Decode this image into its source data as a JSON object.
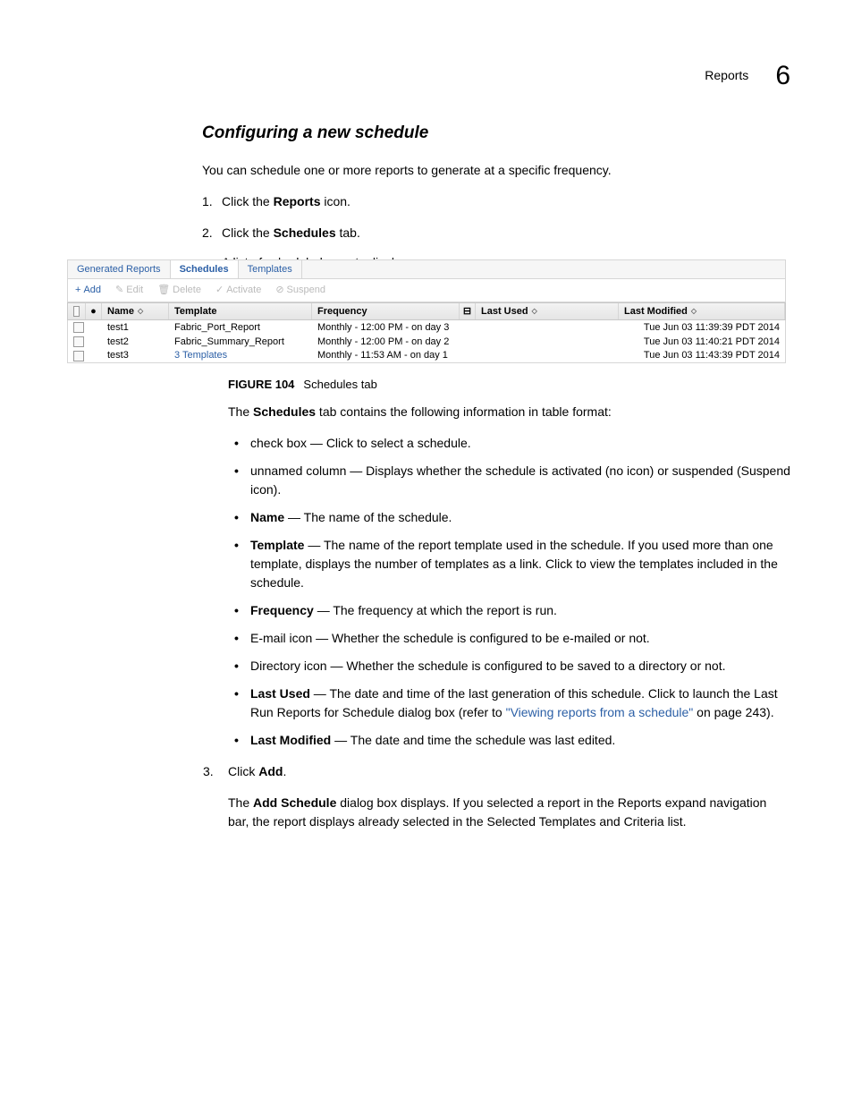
{
  "header": {
    "section": "Reports",
    "chapter": "6"
  },
  "title": "Configuring a new schedule",
  "intro": "You can schedule one or more reports to generate at a specific frequency.",
  "steps12": {
    "s1_pre": "Click the ",
    "s1_b": "Reports",
    "s1_post": " icon.",
    "s2_pre": "Click the ",
    "s2_b": "Schedules",
    "s2_post": " tab.",
    "s2_sub": "A list of scheduled reports display."
  },
  "screenshot": {
    "tabs": {
      "gen": "Generated Reports",
      "sched": "Schedules",
      "tmpl": "Templates"
    },
    "toolbar": {
      "add": "Add",
      "edit": "Edit",
      "del": "Delete",
      "act": "Activate",
      "susp": "Suspend"
    },
    "cols": {
      "name": "Name",
      "tmpl": "Template",
      "freq": "Frequency",
      "lu": "Last Used",
      "lm": "Last Modified"
    },
    "rows": [
      {
        "name": "test1",
        "tmpl": "Fabric_Port_Report",
        "tmpl_link": false,
        "freq": "Monthly - 12:00 PM - on day 3",
        "lm": "Tue Jun 03 11:39:39 PDT 2014"
      },
      {
        "name": "test2",
        "tmpl": "Fabric_Summary_Report",
        "tmpl_link": false,
        "freq": "Monthly - 12:00 PM - on day 2",
        "lm": "Tue Jun 03 11:40:21 PDT 2014"
      },
      {
        "name": "test3",
        "tmpl": "3 Templates",
        "tmpl_link": true,
        "freq": "Monthly - 11:53 AM - on day 1",
        "lm": "Tue Jun 03 11:43:39 PDT 2014"
      }
    ]
  },
  "figure": {
    "label": "FIGURE 104",
    "caption": "Schedules tab"
  },
  "desc_intro_pre": "The ",
  "desc_intro_b": "Schedules",
  "desc_intro_post": " tab contains the following information in table format:",
  "bullets": {
    "b1": "check box — Click to select a schedule.",
    "b2": "unnamed column — Displays whether the schedule is activated (no icon) or suspended (Suspend icon).",
    "b3_b": "Name",
    "b3_r": " — The name of the schedule.",
    "b4_b": "Template",
    "b4_r": " — The name of the report template used in the schedule. If you used more than one template, displays the number of templates as a link. Click to view the templates included in the schedule.",
    "b5_b": "Frequency",
    "b5_r": " — The frequency at which the report is run.",
    "b6": "E-mail icon — Whether the schedule is configured to be e-mailed or not.",
    "b7": "Directory icon — Whether the schedule is configured to be saved to a directory or not.",
    "b8_b": "Last Used",
    "b8_r1": " — The date and time of the last generation of this schedule. Click to launch the Last Run Reports for Schedule dialog box (refer to ",
    "b8_link": "\"Viewing reports from a schedule\"",
    "b8_r2": " on page 243).",
    "b9_b": "Last Modified",
    "b9_r": " — The date and time the schedule was last edited."
  },
  "step3": {
    "pre": "Click ",
    "b": "Add",
    "post": ".",
    "sub_pre": "The ",
    "sub_b": "Add Schedule",
    "sub_post": " dialog box displays. If you selected a report in the Reports expand navigation bar, the report displays already selected in the Selected Templates and Criteria list."
  }
}
